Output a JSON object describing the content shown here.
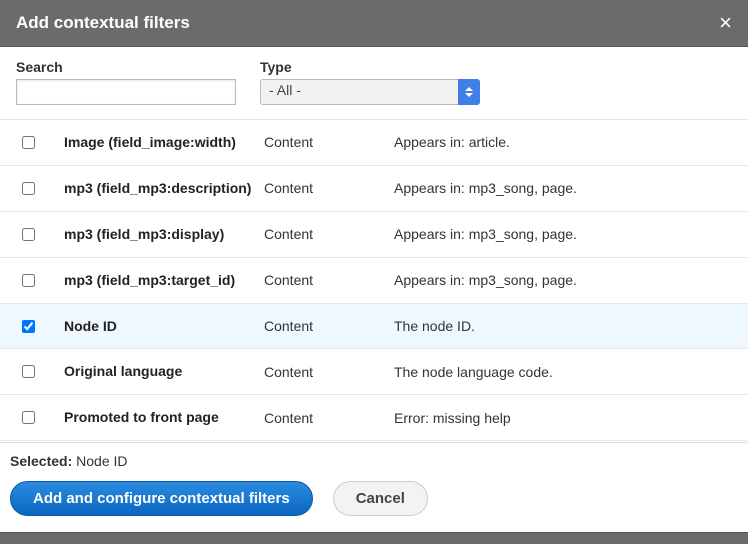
{
  "dialog": {
    "title": "Add contextual filters",
    "close_label": "Close"
  },
  "filters": {
    "search": {
      "label": "Search",
      "value": "",
      "placeholder": ""
    },
    "type": {
      "label": "Type",
      "value": "- All -"
    }
  },
  "rows": [
    {
      "checked": false,
      "name": "Image (field_image:width)",
      "category": "Content",
      "desc": "Appears in: article."
    },
    {
      "checked": false,
      "name": "mp3 (field_mp3:description)",
      "category": "Content",
      "desc": "Appears in: mp3_song, page."
    },
    {
      "checked": false,
      "name": "mp3 (field_mp3:display)",
      "category": "Content",
      "desc": "Appears in: mp3_song, page."
    },
    {
      "checked": false,
      "name": "mp3 (field_mp3:target_id)",
      "category": "Content",
      "desc": "Appears in: mp3_song, page."
    },
    {
      "checked": true,
      "name": "Node ID",
      "category": "Content",
      "desc": "The node ID."
    },
    {
      "checked": false,
      "name": "Original language",
      "category": "Content",
      "desc": "The node language code."
    },
    {
      "checked": false,
      "name": "Promoted to front page",
      "category": "Content",
      "desc": "Error: missing help"
    }
  ],
  "footer": {
    "selected_label": "Selected:",
    "selected_value": "Node ID",
    "submit": "Add and configure contextual filters",
    "cancel": "Cancel"
  }
}
